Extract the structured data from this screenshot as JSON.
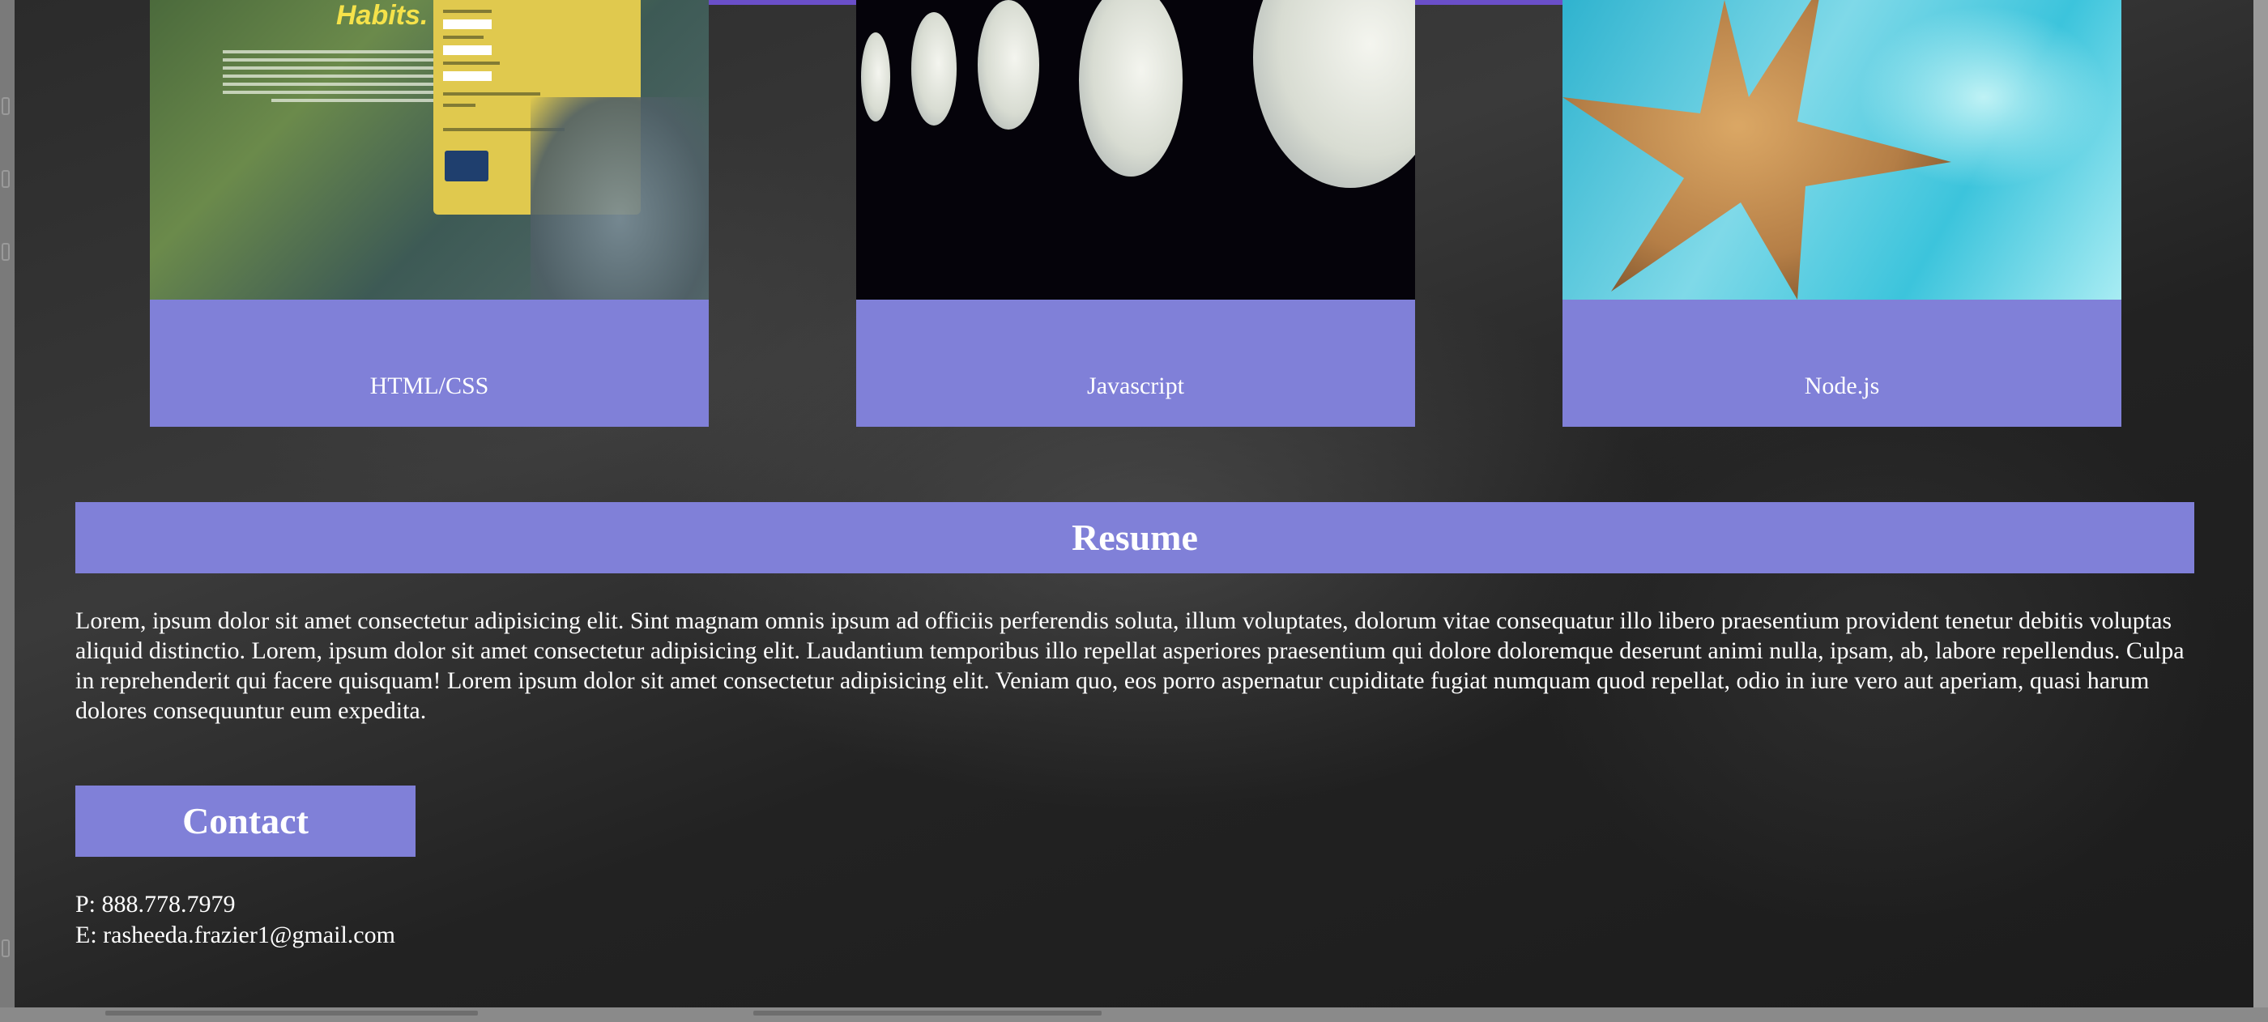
{
  "projects": [
    {
      "label": "HTML/CSS",
      "thumb_headline": "Habits.",
      "thumb_icon": "form-screenshot"
    },
    {
      "label": "Javascript",
      "thumb_icon": "moon-phases-image"
    },
    {
      "label": "Node.js",
      "thumb_icon": "starfish-image"
    }
  ],
  "resume": {
    "heading": "Resume",
    "body": "Lorem, ipsum dolor sit amet consectetur adipisicing elit. Sint magnam omnis ipsum ad officiis perferendis soluta, illum voluptates, dolorum vitae consequatur illo libero praesentium provident tenetur debitis voluptas aliquid distinctio. Lorem, ipsum dolor sit amet consectetur adipisicing elit. Laudantium temporibus illo repellat asperiores praesentium qui dolore doloremque deserunt animi nulla, ipsam, ab, labore repellendus. Culpa in reprehenderit qui facere quisquam! Lorem ipsum dolor sit amet consectetur adipisicing elit. Veniam quo, eos porro aspernatur cupiditate fugiat numquam quod repellat, odio in iure vero aut aperiam, quasi harum dolores consequuntur eum expedita."
  },
  "contact": {
    "heading": "Contact",
    "phone": "P: 888.778.7979",
    "email": "E: rasheeda.frazier1@gmail.com"
  },
  "colors": {
    "accent": "#8080d8",
    "top_accent": "#6a4fc9",
    "text": "#ffffff"
  }
}
